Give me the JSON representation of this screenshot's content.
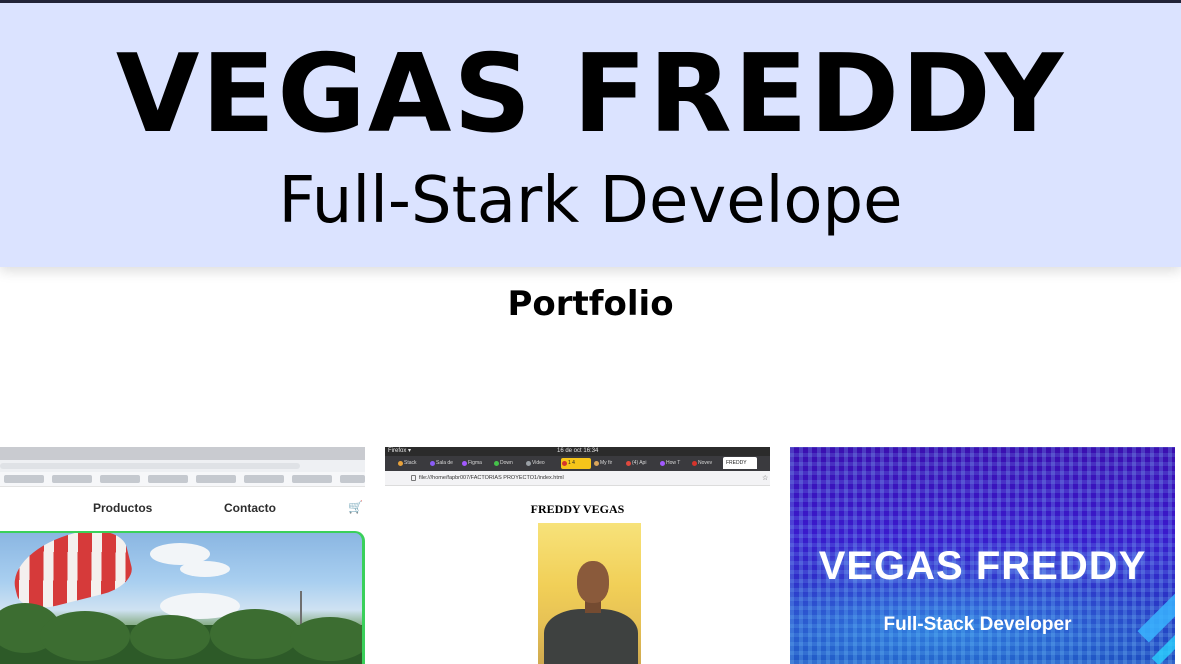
{
  "hero": {
    "title": "VEGAS FREDDY",
    "subtitle": "Full-Stark Develope",
    "background_color": "#dbe3ff"
  },
  "section": {
    "heading": "Portfolio"
  },
  "portfolio": {
    "items": [
      {
        "nav": [
          "Productos",
          "Contacto"
        ],
        "cart_icon": "cart-icon"
      },
      {
        "menu": "Firefox ▾",
        "clock": "16 de oct 16:34",
        "tabs": [
          "Stack",
          "Sala de",
          "Figma",
          "Down",
          "Video",
          "1 4",
          "My fir",
          "(4) Api",
          "How T",
          "Novev"
        ],
        "active_tab": "FREDDY",
        "address": "file:///home/fapbr007/FACTORIAS PROYECTO1/index.html",
        "heading": "FREDDY VEGAS"
      },
      {
        "title": "VEGAS FREDDY",
        "subtitle": "Full-Stack Developer"
      }
    ]
  }
}
